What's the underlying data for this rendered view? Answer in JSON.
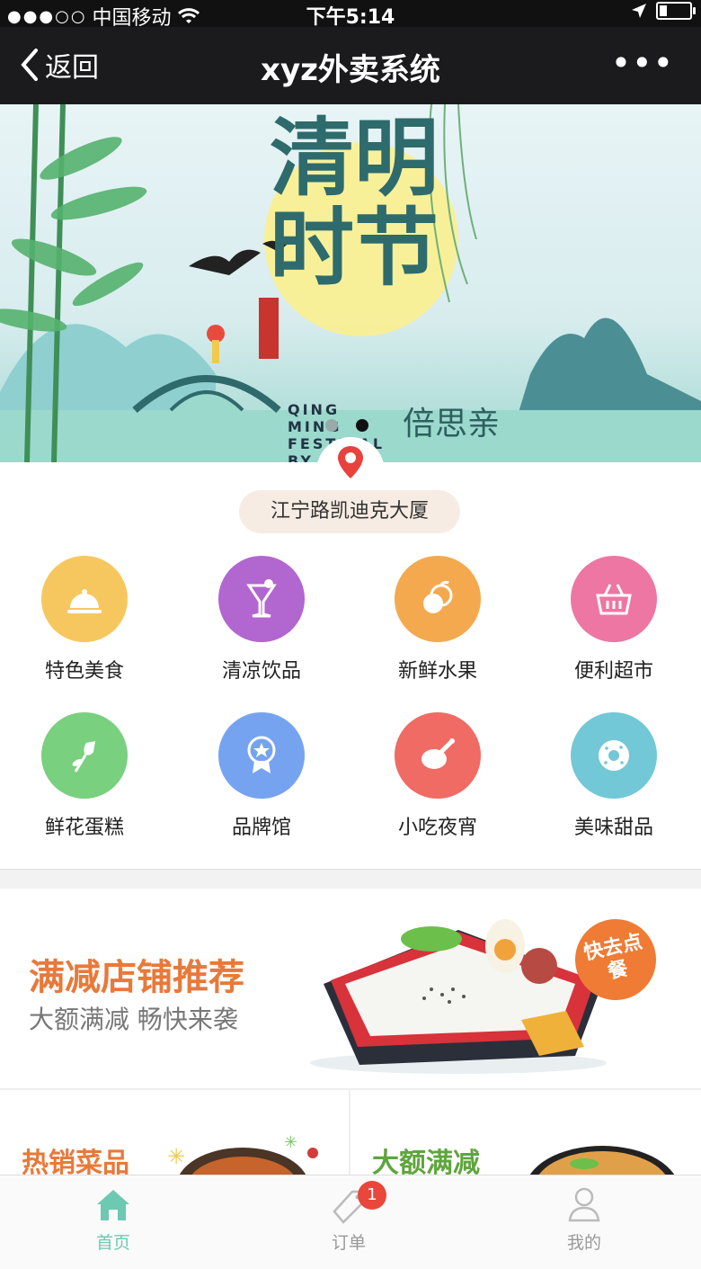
{
  "status_bar": {
    "signal": "●●●○○",
    "carrier": "中国移动",
    "time": "下午5:14"
  },
  "nav": {
    "back_label": "返回",
    "title": "xyz外卖系统",
    "more_label": "•••"
  },
  "banner": {
    "title_line1": "清明",
    "title_line2": "时节",
    "subtitle": "倍思亲",
    "english": "QING MING FESTIVAL BY",
    "slides_total": 2,
    "active_slide": 2
  },
  "location": {
    "address": "江宁路凯迪克大厦",
    "pin_color": "#e8423e"
  },
  "categories": [
    {
      "label": "特色美食",
      "icon": "food-cloche-icon",
      "color": "#f7c75f"
    },
    {
      "label": "清凉饮品",
      "icon": "cocktail-icon",
      "color": "#b266cf"
    },
    {
      "label": "新鲜水果",
      "icon": "orange-fruit-icon",
      "color": "#f4a94e"
    },
    {
      "label": "便利超市",
      "icon": "shopping-basket-icon",
      "color": "#ee76a3"
    },
    {
      "label": "鲜花蛋糕",
      "icon": "rose-flower-icon",
      "color": "#79d07f"
    },
    {
      "label": "品牌馆",
      "icon": "award-badge-icon",
      "color": "#76a3f0"
    },
    {
      "label": "小吃夜宵",
      "icon": "chicken-leg-icon",
      "color": "#ef6b64"
    },
    {
      "label": "美味甜品",
      "icon": "donut-icon",
      "color": "#72c8d6"
    }
  ],
  "promo": {
    "title": "满减店铺推荐",
    "subtitle": "大额满减 畅快来袭",
    "badge": "快去点餐"
  },
  "feature_cards": [
    {
      "title": "热销菜品",
      "color": "#e8793a"
    },
    {
      "title": "大额满减",
      "color": "#5fa53d"
    }
  ],
  "tabbar": {
    "tabs": [
      {
        "label": "首页",
        "icon": "home-icon",
        "active": true
      },
      {
        "label": "订单",
        "icon": "order-tag-icon",
        "active": false,
        "badge": "1"
      },
      {
        "label": "我的",
        "icon": "user-profile-icon",
        "active": false
      }
    ],
    "active_color": "#6dc9b1"
  }
}
